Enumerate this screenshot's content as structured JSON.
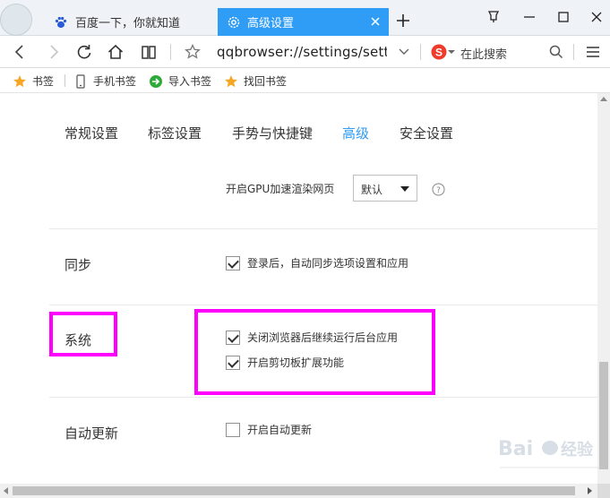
{
  "tabs": [
    {
      "title": "百度一下，你就知道",
      "icon": "baidu-paw-icon",
      "active": false
    },
    {
      "title": "高级设置",
      "icon": "settings-gear-icon",
      "active": true
    }
  ],
  "toolbar": {
    "url": "qqbrowser://settings/setting",
    "search_placeholder": "在此搜索"
  },
  "bookmarks": [
    {
      "label": "书签",
      "icon": "star-icon"
    },
    {
      "label": "手机书签",
      "icon": "phone-icon"
    },
    {
      "label": "导入书签",
      "icon": "import-arrow-icon"
    },
    {
      "label": "找回书签",
      "icon": "star-icon"
    }
  ],
  "settings_tabs": [
    {
      "label": "常规设置",
      "active": false
    },
    {
      "label": "标签设置",
      "active": false
    },
    {
      "label": "手势与快捷键",
      "active": false
    },
    {
      "label": "高级",
      "active": true
    },
    {
      "label": "安全设置",
      "active": false
    }
  ],
  "gpu": {
    "label": "开启GPU加速渲染网页",
    "value": "默认"
  },
  "sync": {
    "title": "同步",
    "option": {
      "label": "登录后，自动同步选项设置和应用",
      "checked": true
    }
  },
  "system": {
    "title": "系统",
    "options": [
      {
        "label": "关闭浏览器后继续运行后台应用",
        "checked": true
      },
      {
        "label": "开启剪切板扩展功能",
        "checked": true
      }
    ]
  },
  "update": {
    "title": "自动更新",
    "option": {
      "label": "开启自动更新",
      "checked": false
    }
  },
  "colors": {
    "accent": "#2f9cf5",
    "highlight": "#ff00ff"
  }
}
